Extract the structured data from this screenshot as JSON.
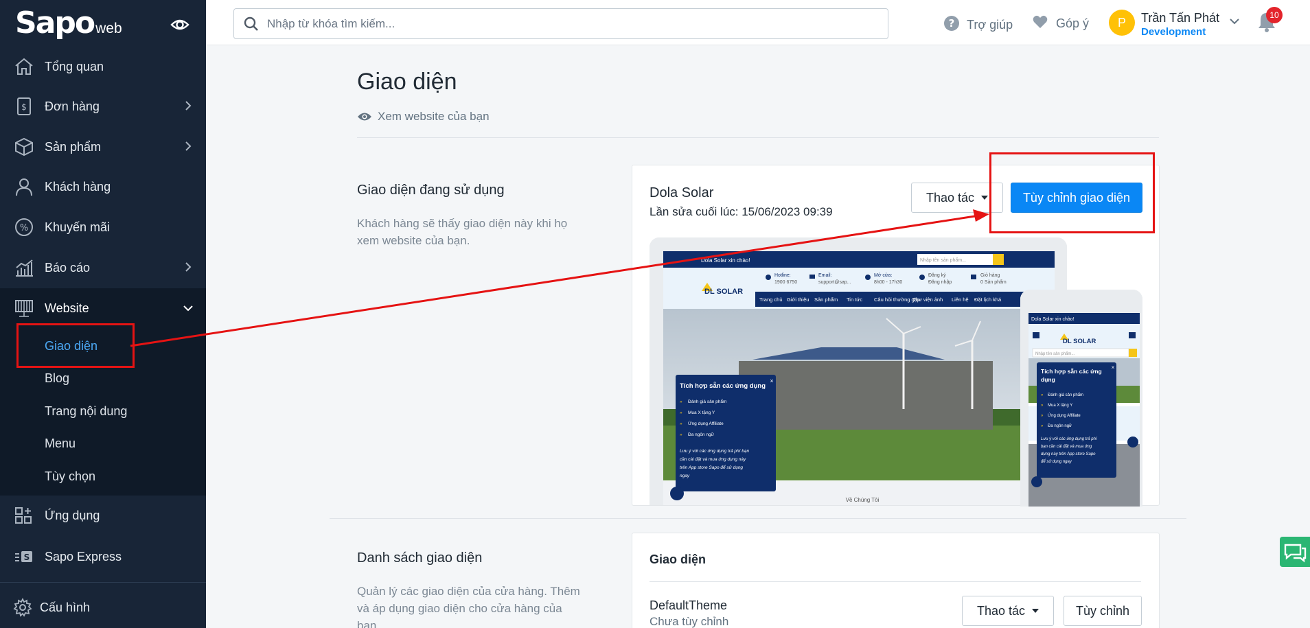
{
  "brand": {
    "logo_main": "Sapo",
    "logo_sub": "web"
  },
  "sidebar": {
    "items": [
      {
        "label": "Tổng quan",
        "icon": "home-icon"
      },
      {
        "label": "Đơn hàng",
        "icon": "order-icon"
      },
      {
        "label": "Sản phẩm",
        "icon": "box-icon"
      },
      {
        "label": "Khách hàng",
        "icon": "user-icon"
      },
      {
        "label": "Khuyến mãi",
        "icon": "percent-icon"
      },
      {
        "label": "Báo cáo",
        "icon": "chart-icon"
      },
      {
        "label": "Website",
        "icon": "website-icon"
      },
      {
        "label": "Ứng dụng",
        "icon": "apps-icon"
      },
      {
        "label": "Sapo Express",
        "icon": "sapo-express-icon"
      },
      {
        "label": "Cấu hình",
        "icon": "gear-icon"
      }
    ],
    "website_sub": [
      {
        "label": "Giao diện"
      },
      {
        "label": "Blog"
      },
      {
        "label": "Trang nội dung"
      },
      {
        "label": "Menu"
      },
      {
        "label": "Tùy chọn"
      }
    ]
  },
  "topbar": {
    "search_placeholder": "Nhập từ khóa tìm kiếm...",
    "help": "Trợ giúp",
    "feedback": "Góp ý",
    "user_initial": "P",
    "user_name": "Trần Tấn Phát",
    "user_role": "Development",
    "notif_count": "10"
  },
  "main": {
    "title": "Giao diện",
    "view_site": "Xem website của bạn",
    "current": {
      "title": "Giao diện đang sử dụng",
      "desc": "Khách hàng sẽ thấy giao diện này khi họ xem website của bạn.",
      "theme_name": "Dola Solar",
      "last_edited": "Lần sửa cuối lúc: 15/06/2023 09:39",
      "actions_label": "Thao tác",
      "customize_label": "Tùy chỉnh giao diện"
    },
    "list": {
      "title": "Danh sách giao diện",
      "desc": "Quản lý các giao diện của cửa hàng. Thêm và áp dụng giao diện cho cửa hàng của bạn",
      "card_title": "Giao diện",
      "default_name": "DefaultTheme",
      "default_status": "Chưa tùy chỉnh",
      "actions_label": "Thao tác",
      "customize_label": "Tùy chỉnh"
    }
  },
  "preview": {
    "welcome": "Dola Solar xin chào!",
    "search_placeholder": "Nhập tên sản phẩm...",
    "hotline_label": "Hotline:",
    "hotline": "1900 6750",
    "email_label": "Email:",
    "email": "support@sap...",
    "hours_label": "Mở cửa:",
    "hours": "8h00 - 17h30",
    "account_label": "Đăng ký",
    "account_sub": "Đăng nhập",
    "cart_label": "Giỏ hàng",
    "cart_sub": "0 Sản phẩm",
    "logo": "DL SOLAR",
    "nav": [
      "Trang chủ",
      "Giới thiệu",
      "Sản phẩm",
      "Tin tức",
      "Câu hỏi thường gặp",
      "Thư viện ảnh",
      "Liên hệ",
      "Đặt lịch khá"
    ],
    "popup_title": "Tích hợp sẵn các ứng dụng",
    "popup_items": [
      "Đánh giá sản phẩm",
      "Mua X tặng Y",
      "Ứng dụng Affiliate",
      "Đa ngôn ngữ"
    ],
    "popup_note": "Lưu ý với các ứng dụng trả phí bạn cần cài đặt và mua ứng dụng này trên App store Sapo để sử dụng ngay",
    "about": "Về Chúng Tôi",
    "mobile_search_placeholder": "Nhập tên sản phẩm..."
  },
  "colors": {
    "sidebar": "#182537",
    "accent": "#0a87f5",
    "annotation": "#e51313",
    "preview_navy": "#0f2e6b",
    "preview_yellow": "#f5c518"
  }
}
